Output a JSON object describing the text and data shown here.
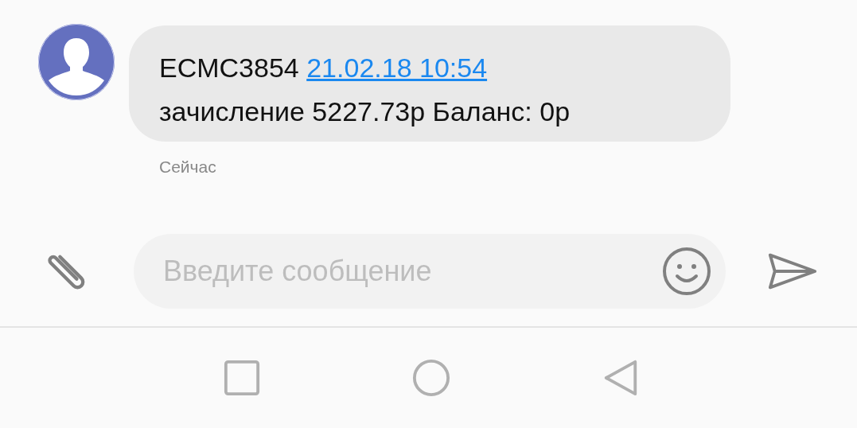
{
  "message": {
    "text_before_link": "ECMC3854",
    "link": "21.02.18 10:54",
    "text_after_link": "зачисление 5227.73р Баланс: 0р",
    "time": "Сейчас"
  },
  "composer": {
    "placeholder": "Введите сообщение"
  }
}
